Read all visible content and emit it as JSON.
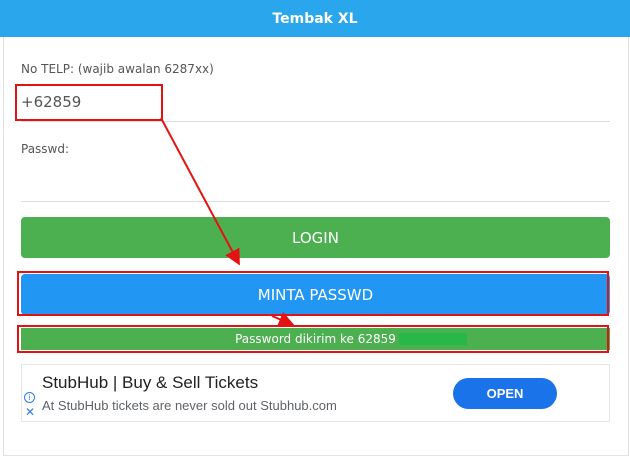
{
  "header": {
    "title": "Tembak XL"
  },
  "form": {
    "phone_label": "No TELP: (wajib awalan 6287xx)",
    "phone_value": "+62859",
    "password_label": "Passwd:",
    "password_value": "",
    "login_label": "LOGIN",
    "minta_label": "MINTA PASSWD",
    "status_text": "Password dikirim ke 62859"
  },
  "ad": {
    "title": "StubHub | Buy & Sell Tickets",
    "description": "At StubHub tickets are never sold out Stubhub.com",
    "cta_label": "OPEN",
    "info_glyph": "i",
    "close_glyph": "✕"
  },
  "colors": {
    "header": "#29a6ec",
    "login_button": "#4caf50",
    "minta_button": "#2196f3",
    "status": "#4caf50",
    "annotation": "#e41313",
    "ad_cta": "#1a73e8"
  }
}
